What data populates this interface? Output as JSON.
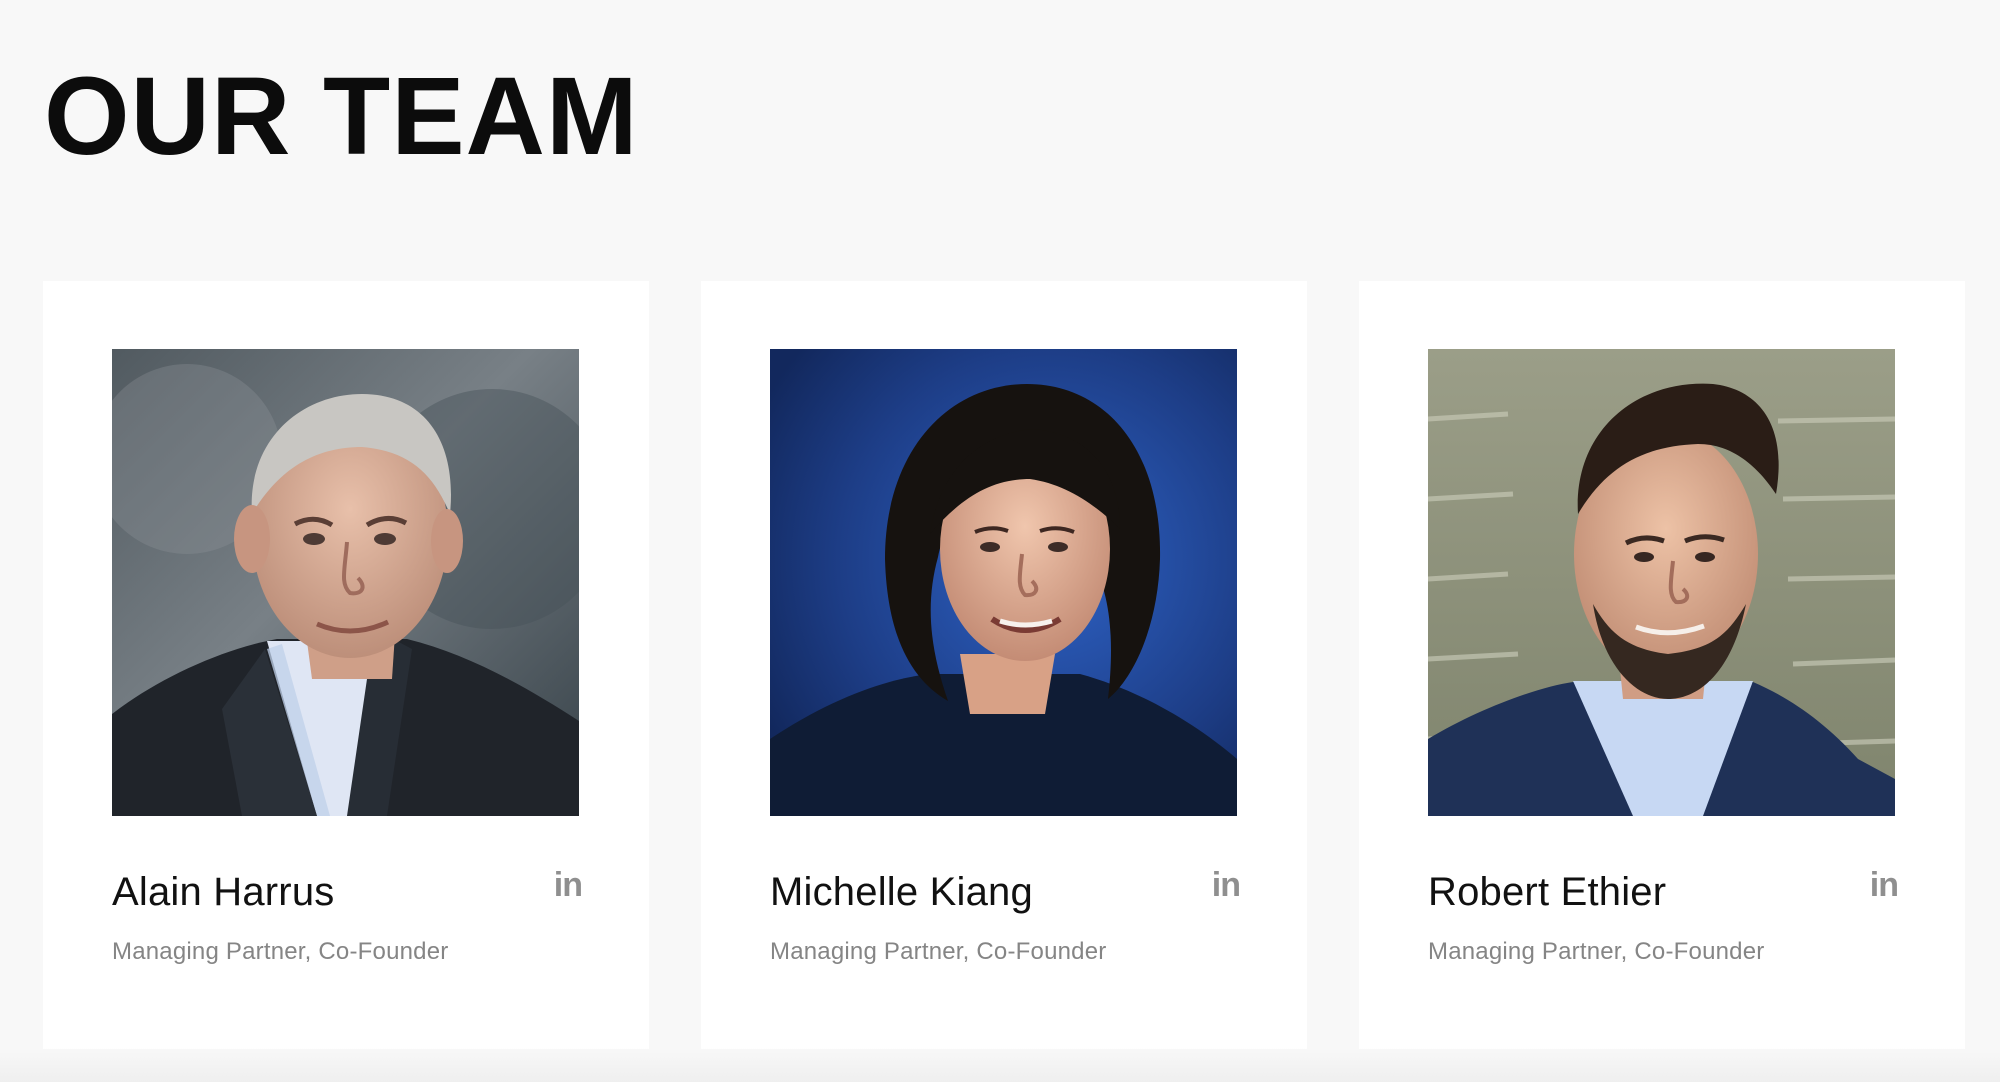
{
  "page": {
    "title": "OUR TEAM"
  },
  "team": {
    "members": [
      {
        "name": "Alain Harrus",
        "role": "Managing Partner, Co-Founder",
        "social_label": "in",
        "social_icon": "linkedin-icon"
      },
      {
        "name": "Michelle Kiang",
        "role": "Managing Partner, Co-Founder",
        "social_label": "in",
        "social_icon": "linkedin-icon"
      },
      {
        "name": "Robert Ethier",
        "role": "Managing Partner, Co-Founder",
        "social_label": "in",
        "social_icon": "linkedin-icon"
      }
    ]
  },
  "colors": {
    "page_background": "#f8f8f8",
    "card_background": "#ffffff",
    "title_text": "#0c0c0c",
    "name_text": "#111111",
    "role_text": "#858585",
    "icon_gray": "#8f8f8f"
  }
}
